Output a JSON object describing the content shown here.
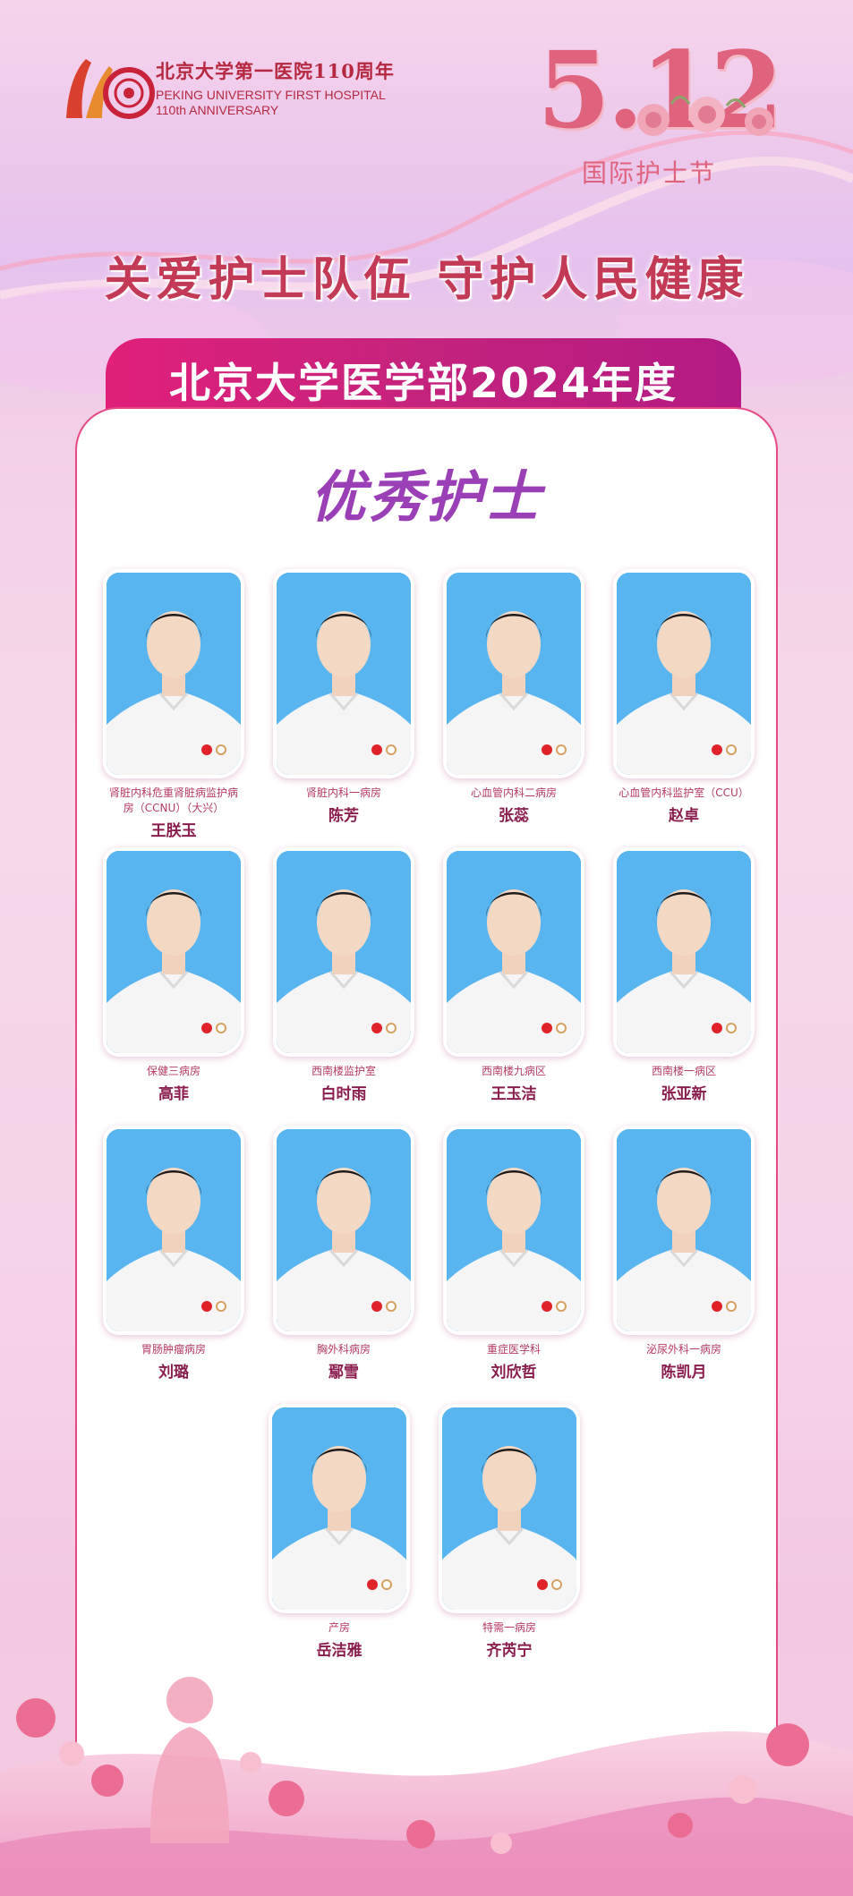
{
  "header": {
    "hospital_cn": "北京大学第一医院110周年",
    "hospital_en": "PEKING UNIVERSITY FIRST HOSPITAL",
    "anniversary_en": "110th ANNIVERSARY",
    "date": "5.12",
    "festival": "国际护士节"
  },
  "slogan": "关爱护士队伍 守护人民健康",
  "banner": "北京大学医学部2024年度",
  "award_title": "优秀护士",
  "nurses": [
    {
      "dept": "肾脏内科危重肾脏病监护病房（CCNU）（大兴）",
      "name": "王朕玉"
    },
    {
      "dept": "肾脏内科一病房",
      "name": "陈芳"
    },
    {
      "dept": "心血管内科二病房",
      "name": "张蕊"
    },
    {
      "dept": "心血管内科监护室（CCU）",
      "name": "赵卓"
    },
    {
      "dept": "保健三病房",
      "name": "高菲"
    },
    {
      "dept": "西南楼监护室",
      "name": "白时雨"
    },
    {
      "dept": "西南楼九病区",
      "name": "王玉洁"
    },
    {
      "dept": "西南楼一病区",
      "name": "张亚新"
    },
    {
      "dept": "胃肠肿瘤病房",
      "name": "刘璐"
    },
    {
      "dept": "胸外科病房",
      "name": "鄢雪"
    },
    {
      "dept": "重症医学科",
      "name": "刘欣哲"
    },
    {
      "dept": "泌尿外科一病房",
      "name": "陈凯月"
    },
    {
      "dept": "产房",
      "name": "岳洁雅"
    },
    {
      "dept": "特需一病房",
      "name": "齐芮宁"
    }
  ]
}
